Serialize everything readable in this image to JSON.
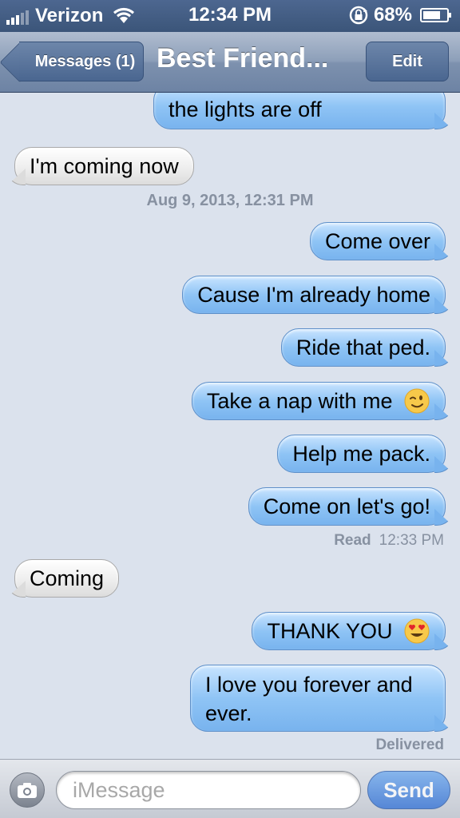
{
  "status_bar": {
    "carrier": "Verizon",
    "time": "12:34 PM",
    "battery": "68%"
  },
  "nav": {
    "back_label": "Messages (1)",
    "title": "Best Friend...",
    "edit_label": "Edit"
  },
  "messages": [
    {
      "text": "the lights are off",
      "direction": "sent"
    },
    {
      "text": "I'm coming now",
      "direction": "received"
    },
    {
      "text": "Come over",
      "direction": "sent"
    },
    {
      "text": "Cause I'm already home",
      "direction": "sent"
    },
    {
      "text": "Ride that ped.",
      "direction": "sent"
    },
    {
      "text": "Take a nap with me",
      "direction": "sent",
      "emoji": "winking-face"
    },
    {
      "text": "Help me pack.",
      "direction": "sent"
    },
    {
      "text": "Come on let's go!",
      "direction": "sent"
    },
    {
      "text": "Coming",
      "direction": "received"
    },
    {
      "text": "THANK YOU",
      "direction": "sent",
      "emoji": "heart-eyes-face"
    },
    {
      "text": "I love you forever and",
      "text_line2": "ever.",
      "direction": "sent"
    }
  ],
  "timestamp": "Aug 9, 2013, 12:31 PM",
  "read_receipt": {
    "label": "Read",
    "time": "12:33 PM"
  },
  "delivered_label": "Delivered",
  "input": {
    "placeholder": "iMessage",
    "send_label": "Send"
  },
  "colors": {
    "background": "#dbe2ed",
    "sent_bubble": "#8fc4f5",
    "received_bubble": "#ececec",
    "navbar": "#8d9fb9",
    "send_button": "#2f6fd6"
  }
}
